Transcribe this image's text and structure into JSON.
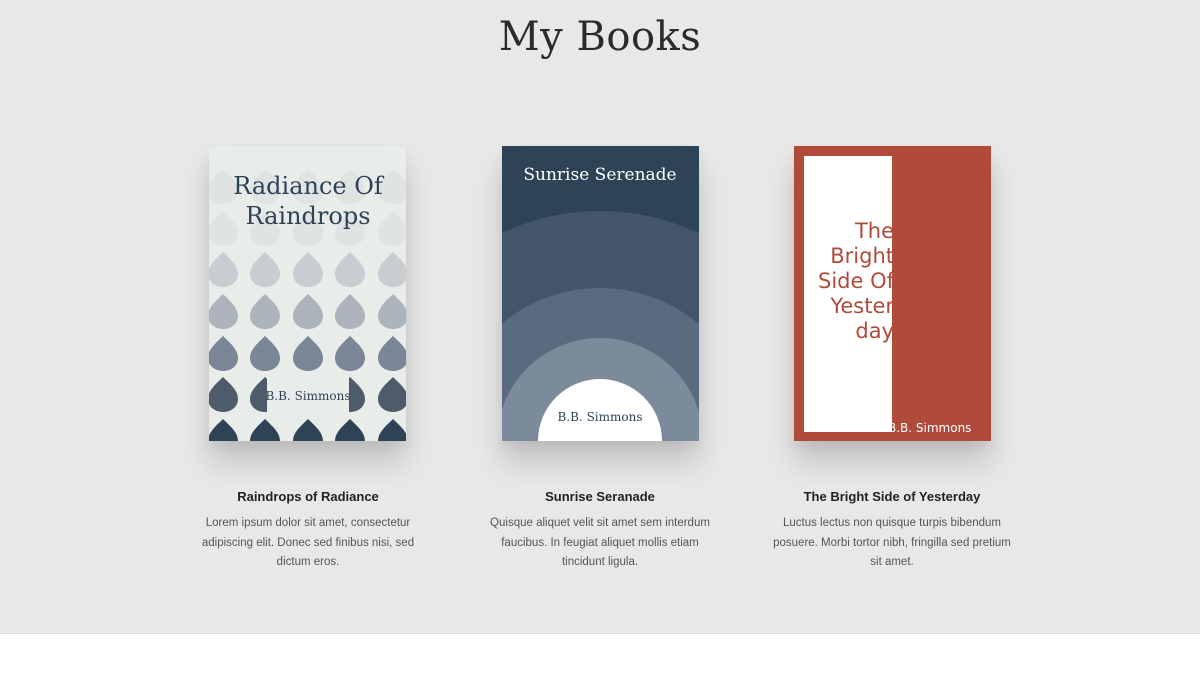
{
  "page": {
    "title": "My Books"
  },
  "books": [
    {
      "cover_title_line1": "Radiance Of",
      "cover_title_line2": "Raindrops",
      "cover_author": "B.B. Simmons",
      "title": "Raindrops of Radiance",
      "description": "Lorem ipsum dolor sit amet, consectetur adipiscing elit. Donec sed finibus nisi, sed dictum eros."
    },
    {
      "cover_title": "Sunrise Serenade",
      "cover_author": "B.B. Simmons",
      "title": "Sunrise Seranade",
      "description": "Quisque aliquet velit sit amet sem interdum faucibus. In feugiat aliquet mollis etiam tincidunt ligula."
    },
    {
      "cover_title_line1": "The",
      "cover_title_line2": "Bright",
      "cover_title_line3": "Side Of",
      "cover_title_line4": "Yester",
      "cover_title_line5": "day",
      "cover_author": "B.B. Simmons",
      "title": "The Bright Side of Yesterday",
      "description": "Luctus lectus non quisque turpis bibendum posuere. Morbi tortor nibh, fringilla sed pretium sit amet."
    }
  ],
  "colors": {
    "section_background": "#e8e8e8",
    "footer_background": "#ffffff",
    "navy": "#2f4357",
    "rust": "#b04b3b",
    "cover_mint": "#e8ede9"
  }
}
